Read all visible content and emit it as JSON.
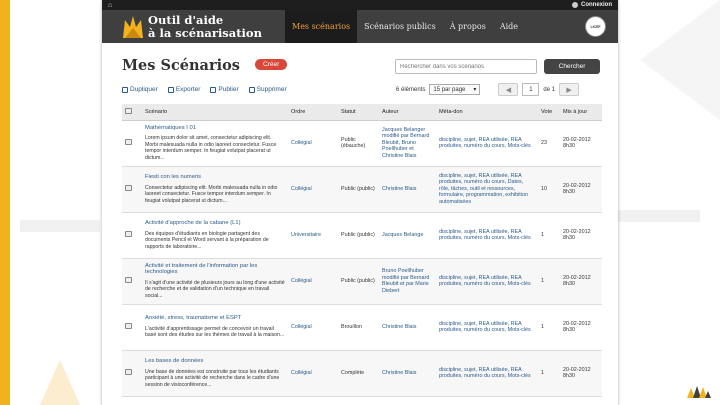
{
  "topbar": {
    "login_label": "Connexion"
  },
  "header": {
    "logo_line1": "Outil d'aide",
    "logo_line2": "à la scénarisation",
    "seal_text": "LICEF",
    "nav": [
      {
        "label": "Mes scénarios",
        "active": true
      },
      {
        "label": "Scénarios publics",
        "active": false
      },
      {
        "label": "À propos",
        "active": false
      },
      {
        "label": "Aide",
        "active": false
      }
    ]
  },
  "page": {
    "title": "Mes Scénarios",
    "create_label": "Créer"
  },
  "search": {
    "placeholder": "Rechercher dans vos scénarios",
    "button_label": "Chercher"
  },
  "toolbar": {
    "duplicate": "Dupliquer",
    "export": "Exporter",
    "publish": "Publier",
    "delete": "Supprimer"
  },
  "pager": {
    "count_text": "6 éléments",
    "per_page": "15 par page",
    "page": "1",
    "of_text": "de 1"
  },
  "columns": [
    "Scénario",
    "Ordre",
    "Statut",
    "Auteur",
    "Méta-don",
    "Vote",
    "Mis à jour"
  ],
  "rows": [
    {
      "title": "Mathématiques I 01",
      "desc": "Lorem ipsum dolor sit amet, consectetur adipiscing elit. Morbi malesuada nulla in odio laoreet consectetur. Fusce tempor interdum semper. In feugiat volutpat placerat ut dictum...",
      "order": "Collégial",
      "status": "Public (ébauche)",
      "author": "Jacques Belanger modifié par Bernard Bleubit, Bruno Poellhuber et Christine Blais",
      "meta": "discipline, sujet, REA utilisée, REA produites, numéro du cours, Mots-clés",
      "votes": "23",
      "updated": "20-02-2012 8h30"
    },
    {
      "title": "Fiesti con les numeris",
      "desc": "Consectetur adipiscing elit. Morbi malesuada nulla in odio laoreet consectetur. Fusce tempor interdum semper. In feugiat volutpat placerat ut dictum...",
      "order": "Collégial",
      "status": "Public (public)",
      "author": "Christine Blais",
      "meta": "discipline, sujet, REA utilisée, REA produites, numéro du cours, Dates, rôle, tâches, outil et ressources, formulaire, programmation, exhibition automatisées",
      "votes": "10",
      "updated": "20-02-2012 8h30"
    },
    {
      "title": "Activité d'approche de la cabane (L1)",
      "desc": "Des équipes d'étudiants en biologie partagent des documents Pencil et Word servant à la préparation de rapports de laboratoire...",
      "order": "Universitaire",
      "status": "Public (public)",
      "author": "Jacques Belange",
      "meta": "discipline, sujet, REA utilisée, REA produites, numéro du cours, Mots-clés",
      "votes": "1",
      "updated": "20-02-2012 8h30"
    },
    {
      "title": "Activité et traitement de l'information par les technologies",
      "desc": "Il s'agit d'une activité de plusieurs jours au long d'une activité de recherche et de validation d'un technique en travail social...",
      "order": "Collégial",
      "status": "Public (public)",
      "author": "Bruno Poellhuber modifié par Bernard Bleubit et par Marie Diebert",
      "meta": "discipline, sujet, REA utilisée, REA produites, numéro du cours, Mots-clés",
      "votes": "1",
      "updated": "20-02-2012 8h30"
    },
    {
      "title": "Anxiété, stress, traumatisme et ESPT",
      "desc": "L'activité d'apprentissage permet de concevoir un travail basé sont des études sur les thèmes de travail à la maison...",
      "order": "Collégial",
      "status": "Brouillon",
      "author": "Christine Blais",
      "meta": "discipline, sujet, REA utilisée, REA produites, numéro du cours, Mots-clés",
      "votes": "1",
      "updated": "20-02-2012 8h30"
    },
    {
      "title": "Les bases de données",
      "desc": "Une base de données est construite par tous les étudiants participant à une activité de recherche dans le cadre d'une session de visioconférence...",
      "order": "Collégial",
      "status": "Complète",
      "author": "Christine Blais",
      "meta": "discipline, sujet, REA utilisée, REA produites, numéro du cours, Mots-clés",
      "votes": "1",
      "updated": "20-02-2012 8h30"
    }
  ],
  "colors": {
    "accent": "#f2b21d",
    "header": "#3f3f3f",
    "create": "#d9463a",
    "link": "#2a5a8a"
  }
}
